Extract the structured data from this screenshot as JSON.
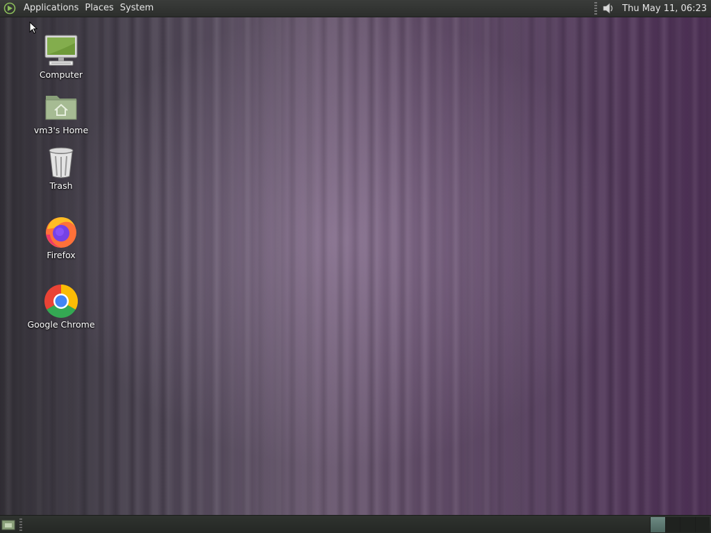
{
  "top_panel": {
    "menus": [
      "Applications",
      "Places",
      "System"
    ],
    "clock": "Thu May 11, 06:23"
  },
  "desktop_icons": [
    {
      "label": "Computer",
      "icon": "computer-icon"
    },
    {
      "label": "vm3's Home",
      "icon": "home-folder-icon"
    },
    {
      "label": "Trash",
      "icon": "trash-icon"
    },
    {
      "label": "Firefox",
      "icon": "firefox-icon"
    },
    {
      "label": "Google Chrome",
      "icon": "chrome-icon"
    }
  ],
  "colors": {
    "panel": "#2c2e2c",
    "panel_text": "#e6e6e6",
    "desktop_purple": "#553e5d",
    "workspace_active": "#5d7a72"
  }
}
